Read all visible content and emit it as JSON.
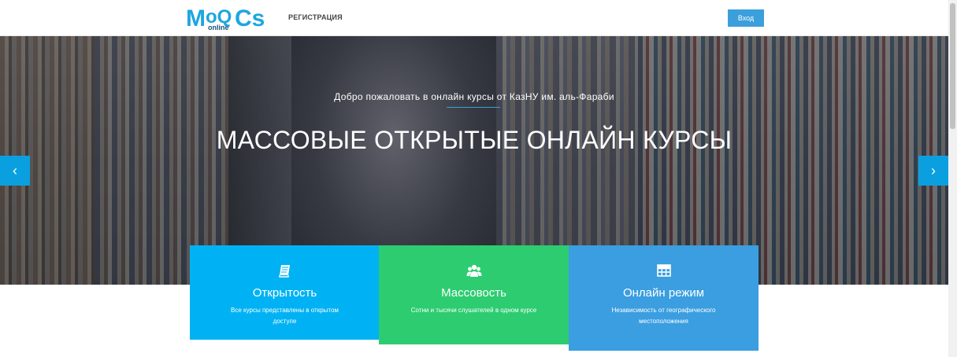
{
  "header": {
    "logo_main": "M",
    "logo_oo": "oQ",
    "logo_cs": "Cs",
    "logo_sub": "online",
    "nav_register": "РЕГИСТРАЦИЯ",
    "login_label": "Вход"
  },
  "hero": {
    "subtitle": "Добро пожаловать в онлайн курсы от КазНУ им. аль-Фараби",
    "title": "МАССОВЫЕ ОТКРЫТЫЕ ОНЛАЙН КУРСЫ",
    "prev_icon": "‹",
    "next_icon": "›"
  },
  "features": [
    {
      "icon": "book-icon",
      "title": "Открытость",
      "desc": "Все курсы представлены в открытом доступе"
    },
    {
      "icon": "users-icon",
      "title": "Массовость",
      "desc": "Сотни и тысячи слушателей в одном курсе"
    },
    {
      "icon": "table-icon",
      "title": "Онлайн режим",
      "desc": "Независимость от географического местоположения"
    }
  ],
  "colors": {
    "accent": "#3b9fdc",
    "feature_1": "#00b2f3",
    "feature_2": "#2dcc70",
    "feature_3": "#3a9ee0"
  }
}
